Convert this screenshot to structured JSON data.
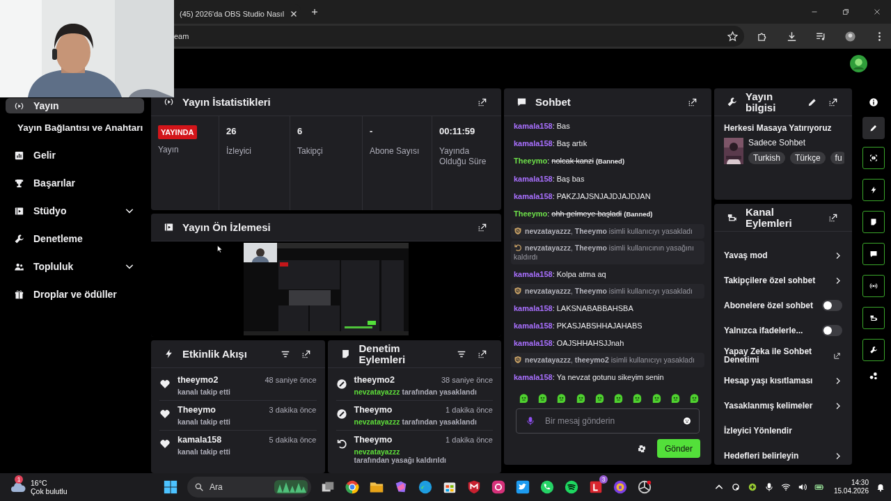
{
  "browser": {
    "tab_title": "(45) 2026'da OBS Studio Nasıl",
    "address": "eam"
  },
  "sidebar": {
    "items": [
      {
        "kind": "main",
        "label": "Yayın",
        "selected": true
      },
      {
        "kind": "sub",
        "label": "Yayın Bağlantısı ve Anahtarı",
        "selected": false
      },
      {
        "kind": "main",
        "label": "Gelir",
        "selected": false
      },
      {
        "kind": "main",
        "label": "Başarılar",
        "selected": false
      },
      {
        "kind": "main",
        "label": "Stüdyo",
        "selected": false,
        "expanded": false
      },
      {
        "kind": "main",
        "label": "Denetleme",
        "selected": false
      },
      {
        "kind": "main",
        "label": "Topluluk",
        "selected": false,
        "expanded": false
      },
      {
        "kind": "main",
        "label": "Droplar ve ödüller",
        "selected": false
      }
    ]
  },
  "stats": {
    "title": "Yayın İstatistikleri",
    "status": {
      "badge": "YAYINDA",
      "label": "Yayın"
    },
    "items": [
      {
        "value": "26",
        "label": "İzleyici"
      },
      {
        "value": "6",
        "label": "Takipçi"
      },
      {
        "value": "-",
        "label": "Abone Sayısı"
      },
      {
        "value": "00:11:59",
        "label": "Yayında Olduğu Süre"
      }
    ]
  },
  "preview": {
    "title": "Yayın Ön İzlemesi"
  },
  "activity": {
    "title": "Etkinlik Akışı",
    "items": [
      {
        "user": "theeymo2",
        "text": "kanalı takip etti",
        "time": "48 saniye önce"
      },
      {
        "user": "Theeymo",
        "text": "kanalı takip etti",
        "time": "3 dakika önce"
      },
      {
        "user": "kamala158",
        "text": "kanalı takip etti",
        "time": "5 dakika önce"
      }
    ]
  },
  "moderation": {
    "title": "Denetim Eylemleri",
    "items": [
      {
        "kind": "ban",
        "user": "theeymo2",
        "actor": "nevzatayazzz",
        "text": "tarafından yasaklandı",
        "time": "38 saniye önce"
      },
      {
        "kind": "ban",
        "user": "Theeymo",
        "actor": "nevzatayazzz",
        "text": "tarafından yasaklandı",
        "time": "1 dakika önce"
      },
      {
        "kind": "unban",
        "user": "Theeymo",
        "actor": "nevzatayazzz",
        "text": "tarafından yasağı kaldırıldı",
        "time": "1 dakika önce"
      }
    ]
  },
  "chat": {
    "title": "Sohbet",
    "messages": [
      {
        "kind": "message",
        "user": "kamala158",
        "color": "#a970ff",
        "sep": ":",
        "text": "Bas",
        "banned": false
      },
      {
        "kind": "message",
        "user": "kamala158",
        "color": "#a970ff",
        "sep": ":",
        "text": "Baş artık",
        "banned": false
      },
      {
        "kind": "message",
        "user": "Theeymo",
        "color": "#6ee04a",
        "sep": ":",
        "text": "nolcak kanzi",
        "banned": true,
        "note": "(Banned)"
      },
      {
        "kind": "message",
        "user": "kamala158",
        "color": "#a970ff",
        "sep": ":",
        "text": "Baş bas",
        "banned": false
      },
      {
        "kind": "message",
        "user": "kamala158",
        "color": "#a970ff",
        "sep": ":",
        "text": "PAKZJAJSNJAJDJAJDJAN",
        "banned": false
      },
      {
        "kind": "message",
        "user": "Theeymo",
        "color": "#6ee04a",
        "sep": ":",
        "text": "ohh gelmeye başladi",
        "banned": true,
        "note": "(Banned)"
      },
      {
        "kind": "ban",
        "text": "**nevzatayazzz**, **Theeymo** isimli kullanıcıyı yasakladı"
      },
      {
        "kind": "unban",
        "text": "**nevzatayazzz**, **Theeymo** isimli kullanıcının yasağını kaldırdı"
      },
      {
        "kind": "message",
        "user": "kamala158",
        "color": "#a970ff",
        "sep": ":",
        "text": "Kolpa atma aq",
        "banned": false
      },
      {
        "kind": "ban",
        "text": "**nevzatayazzz**, **Theeymo** isimli kullanıcıyı yasakladı"
      },
      {
        "kind": "message",
        "user": "kamala158",
        "color": "#a970ff",
        "sep": ":",
        "text": "LAKSNABABBAHSBA",
        "banned": false
      },
      {
        "kind": "message",
        "user": "kamala158",
        "color": "#a970ff",
        "sep": ":",
        "text": "PKASJABSHHAJAHABS",
        "banned": false
      },
      {
        "kind": "message",
        "user": "kamala158",
        "color": "#a970ff",
        "sep": ":",
        "text": "OAJSHHAHSJJnah",
        "banned": false
      },
      {
        "kind": "ban",
        "text": "**nevzatayazzz**, **theeymo2** isimli kullanıcıyı yasakladı"
      },
      {
        "kind": "message",
        "user": "kamala158",
        "color": "#a970ff",
        "sep": ":",
        "text": "Ya nevzat gotunu sikeyim senin",
        "banned": false
      }
    ],
    "placeholder": "Bir mesaj gönderin",
    "send": "Gönder"
  },
  "stream_info": {
    "title": "Yayın bilgisi",
    "stream_title": "Herkesi Masaya Yatırıyoruz",
    "category": "Sadece Sohbet",
    "tags": [
      "Turkish",
      "Türkçe",
      "fu"
    ]
  },
  "channel_actions": {
    "title": "Kanal Eylemleri",
    "items": [
      {
        "kind": "nav",
        "label": "Yavaş mod"
      },
      {
        "kind": "nav",
        "label": "Takipçilere özel sohbet"
      },
      {
        "kind": "toggle",
        "label": "Abonelere özel sohbet",
        "on": false
      },
      {
        "kind": "toggle",
        "label": "Yalnızca ifadelerle...",
        "on": false
      },
      {
        "kind": "external",
        "label": "Yapay Zeka ile Sohbet Denetimi"
      },
      {
        "kind": "nav",
        "label": "Hesap yaşı kısıtlaması"
      },
      {
        "kind": "nav",
        "label": "Yasaklanmış kelimeler"
      },
      {
        "kind": "plain",
        "label": "İzleyici Yönlendir"
      },
      {
        "kind": "nav",
        "label": "Hedefleri belirleyin"
      }
    ]
  },
  "taskbar": {
    "weather": {
      "temp": "16°C",
      "desc": "Çok bulutlu",
      "badge": "1"
    },
    "search": {
      "placeholder": "Ara"
    },
    "app_badge": "3",
    "time": "14:30",
    "date": "15.04.2026"
  }
}
